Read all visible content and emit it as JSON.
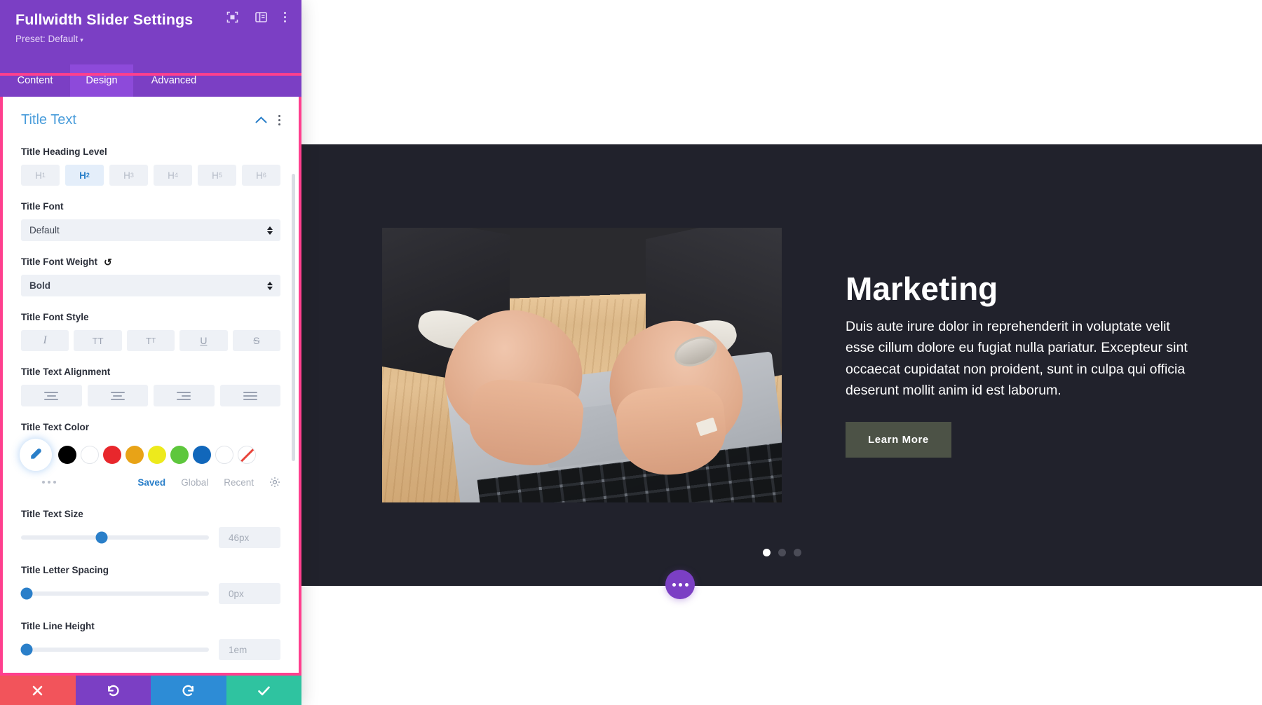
{
  "modal": {
    "title": "Fullwidth Slider Settings",
    "preset_label": "Preset: Default",
    "preset_caret": "▾",
    "header_icons": [
      {
        "name": "focus-frame-icon"
      },
      {
        "name": "layout-panel-icon"
      },
      {
        "name": "kebab-menu-icon"
      }
    ],
    "tabs": [
      {
        "label": "Content",
        "active": false
      },
      {
        "label": "Design",
        "active": true
      },
      {
        "label": "Advanced",
        "active": false
      }
    ]
  },
  "section": {
    "title": "Title Text",
    "collapse_icon": "chevron-up-icon",
    "menu_icon": "kebab-menu-icon"
  },
  "fields": {
    "heading_level": {
      "label": "Title Heading Level",
      "options": [
        "H1",
        "H2",
        "H3",
        "H4",
        "H5",
        "H6"
      ],
      "selected": "H2"
    },
    "title_font": {
      "label": "Title Font",
      "value": "Default"
    },
    "title_font_weight": {
      "label": "Title Font Weight",
      "value": "Bold",
      "reset_icon": "↺"
    },
    "title_font_style": {
      "label": "Title Font Style",
      "options": [
        "I",
        "TT",
        "TT",
        "U",
        "S"
      ],
      "option_names": [
        "italic",
        "uppercase",
        "smallcaps",
        "underline",
        "strikethrough"
      ]
    },
    "title_text_alignment": {
      "label": "Title Text Alignment",
      "options": [
        "left",
        "center",
        "right",
        "justify"
      ]
    },
    "title_text_color": {
      "label": "Title Text Color",
      "picker_icon": "eyedropper-icon",
      "swatches": [
        {
          "name": "black",
          "hex": "#000000"
        },
        {
          "name": "white",
          "hex": "#ffffff"
        },
        {
          "name": "red",
          "hex": "#e8272c"
        },
        {
          "name": "orange",
          "hex": "#e8a317"
        },
        {
          "name": "yellow",
          "hex": "#edea1c"
        },
        {
          "name": "green",
          "hex": "#5ec73d"
        },
        {
          "name": "blue",
          "hex": "#1167bb"
        },
        {
          "name": "white-2",
          "hex": "#ffffff"
        },
        {
          "name": "no-color",
          "hex": "transparent"
        }
      ],
      "more_icon": "more-dots-icon",
      "tabs": [
        {
          "label": "Saved",
          "active": true
        },
        {
          "label": "Global",
          "active": false
        },
        {
          "label": "Recent",
          "active": false
        }
      ],
      "settings_icon": "gear-icon"
    },
    "title_text_size": {
      "label": "Title Text Size",
      "value": "46px",
      "knob_percent": 43
    },
    "title_letter_spacing": {
      "label": "Title Letter Spacing",
      "value": "0px",
      "knob_percent": 2
    },
    "title_line_height": {
      "label": "Title Line Height",
      "value": "1em",
      "knob_percent": 2
    }
  },
  "footer": {
    "cancel_icon": "✕",
    "undo_icon": "↺",
    "redo_icon": "↻",
    "save_icon": "✔"
  },
  "preview": {
    "slide_title": "Marketing",
    "slide_description": "Duis aute irure dolor in reprehenderit in voluptate velit esse cillum dolore eu fugiat nulla pariatur. Excepteur sint occaecat cupidatat non proident, sunt in culpa qui officia deserunt mollit anim id est laborum.",
    "button_label": "Learn More",
    "dots": [
      true,
      false,
      false
    ],
    "fab_icon": "more-options-icon",
    "bg_color": "#21222c",
    "button_color": "#4c5246"
  }
}
